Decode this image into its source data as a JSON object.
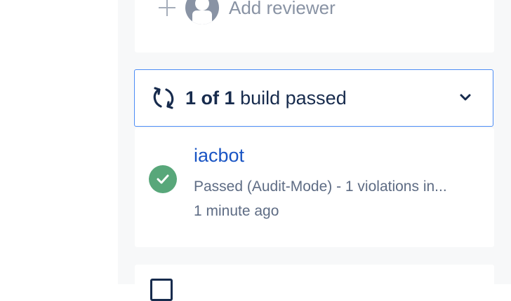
{
  "reviewers": {
    "add_label": "Add reviewer"
  },
  "builds": {
    "count_passed": "1",
    "of_label": "of",
    "count_total": "1",
    "status_text": "build passed",
    "items": [
      {
        "name": "iacbot",
        "status": "Passed (Audit-Mode) - 1 violations in...",
        "time": "1 minute ago"
      }
    ]
  },
  "colors": {
    "accent_border": "#4c8cf5",
    "link": "#1a55c4",
    "success": "#58a77a",
    "muted_text": "#5e6c84"
  }
}
